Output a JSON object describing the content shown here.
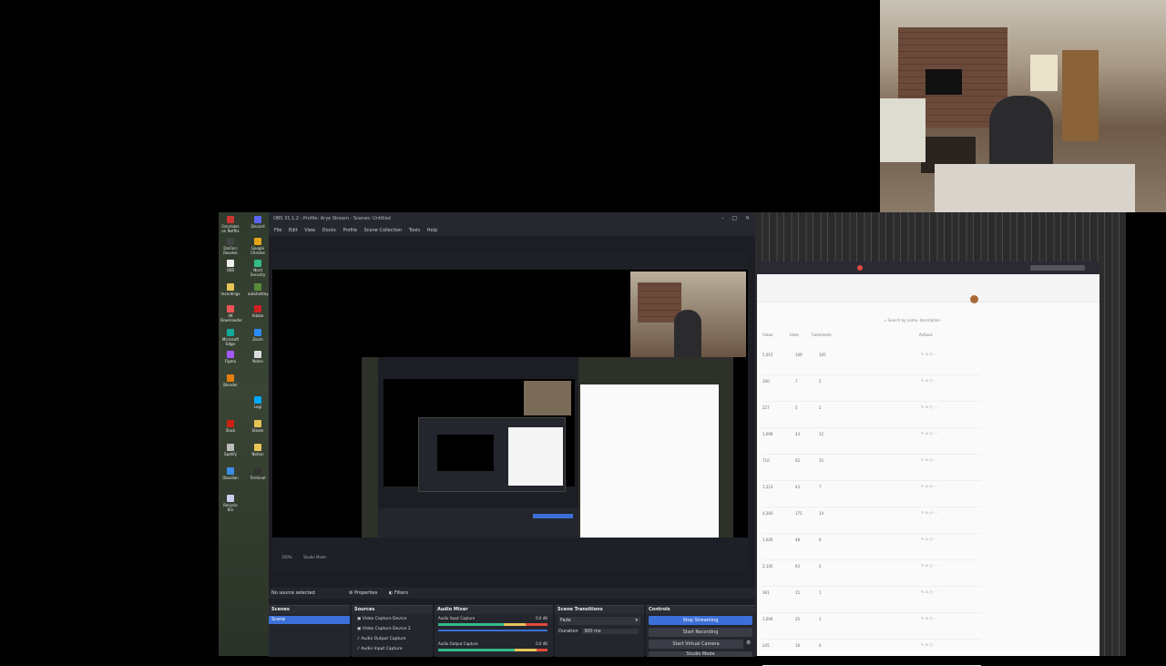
{
  "obs": {
    "title": "OBS 31.1.2 - Profile: Arye Stream - Scenes: Untitled",
    "menu": [
      "File",
      "Edit",
      "View",
      "Docks",
      "Profile",
      "Scene Collection",
      "Tools",
      "Help"
    ],
    "transition_bar": {
      "fps": "100%",
      "mode": "Studio Mode"
    },
    "source_status": "No source selected",
    "properties_label": "Properties",
    "filters_label": "Filters",
    "docks": {
      "scenes": {
        "title": "Scenes",
        "items": [
          "Scene"
        ]
      },
      "sources": {
        "title": "Sources",
        "items": [
          "Video Capture Device",
          "Video Capture Device 2",
          "Audio Output Capture",
          "Audio Input Capture"
        ]
      },
      "audio_mixer": {
        "title": "Audio Mixer",
        "channels": [
          {
            "name": "Audio Input Capture",
            "db": "0.0 dB"
          },
          {
            "name": "Audio Output Capture",
            "db": "0.0 dB"
          }
        ]
      },
      "transitions": {
        "title": "Scene Transitions",
        "type": "Fade",
        "duration_label": "Duration",
        "duration": "300 ms"
      },
      "controls": {
        "title": "Controls",
        "stop_streaming": "Stop Streaming",
        "start_recording": "Start Recording",
        "start_virtual_camera": "Start Virtual Camera",
        "studio_mode": "Studio Mode"
      }
    }
  },
  "browser": {
    "search_placeholder": "Search by name, description",
    "columns": [
      "Views",
      "Likes",
      "Comments",
      "Actions"
    ],
    "rows": [
      [
        "5,015",
        "109",
        "105"
      ],
      [
        "100",
        "7",
        "2"
      ],
      [
        "227",
        "5",
        "2"
      ],
      [
        "1,099",
        "43",
        "12"
      ],
      [
        "710",
        "62",
        "25"
      ],
      [
        "1,223",
        "43",
        "7"
      ],
      [
        "4,260",
        "175",
        "14"
      ],
      [
        "1,026",
        "48",
        "6"
      ],
      [
        "2,145",
        "63",
        "2"
      ],
      [
        "361",
        "15",
        "1"
      ],
      [
        "1,009",
        "25",
        "1"
      ],
      [
        "245",
        "10",
        "0"
      ]
    ]
  },
  "desktop": {
    "icons": [
      "Fairytales on Netflix",
      "Discord",
      "DaVinci Resolve",
      "Google Chrome",
      "OBS",
      "Nord Security",
      "recordings",
      "autohotkey",
      "4K Downloader",
      "Adobe",
      "Microsoft Edge",
      "Zoom",
      "Figma",
      "Notes",
      "Blender",
      "Logi",
      "Slack",
      "Steam",
      "Spotify",
      "Notion",
      "Obsidian",
      "Terminal",
      "Recycle Bin"
    ]
  },
  "colors": {
    "accent": "#3c6fd8",
    "obs_bg": "#1c1e24",
    "selected": "#3c6fd8",
    "record_red": "#e14a3c"
  }
}
